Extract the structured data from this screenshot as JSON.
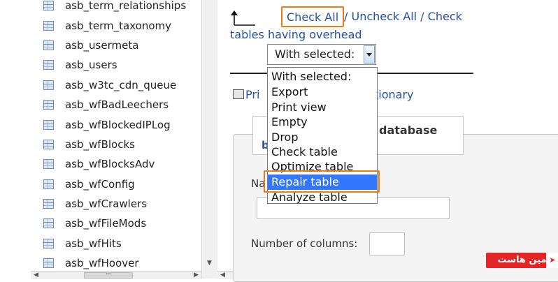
{
  "sidebar": {
    "tables": [
      "asb_term_relationships",
      "asb_term_taxonomy",
      "asb_usermeta",
      "asb_users",
      "asb_w3tc_cdn_queue",
      "asb_wfBadLeechers",
      "asb_wfBlockedIPLog",
      "asb_wfBlocks",
      "asb_wfBlocksAdv",
      "asb_wfConfig",
      "asb_wfCrawlers",
      "asb_wfFileMods",
      "asb_wfHits",
      "asb_wfHoover"
    ]
  },
  "actions": {
    "check_all": "Check All",
    "check_rest": "/ Uncheck All / Check",
    "overhead": "tables having overhead"
  },
  "select": {
    "current": "With selected:",
    "options": [
      "With selected:",
      "Export",
      "Print view",
      "Empty",
      "Drop",
      "Check table",
      "Optimize table",
      "Repair table",
      "Analyze table"
    ],
    "highlighted": "Repair table"
  },
  "background": {
    "print_fragment": "Pri",
    "dictionary_fragment": "tionary",
    "database_fragment": "database",
    "bold_b": "b",
    "name_fragment": "Na",
    "num_columns": "Number of columns:"
  },
  "scroll": {
    "thumb_glyph": "'''"
  },
  "watermark": {
    "text": "مین هاست",
    "icon": "rocket-icon"
  },
  "colors": {
    "link": "#2352a4",
    "highlight": "#f07a1a",
    "selection": "#3377ff"
  }
}
